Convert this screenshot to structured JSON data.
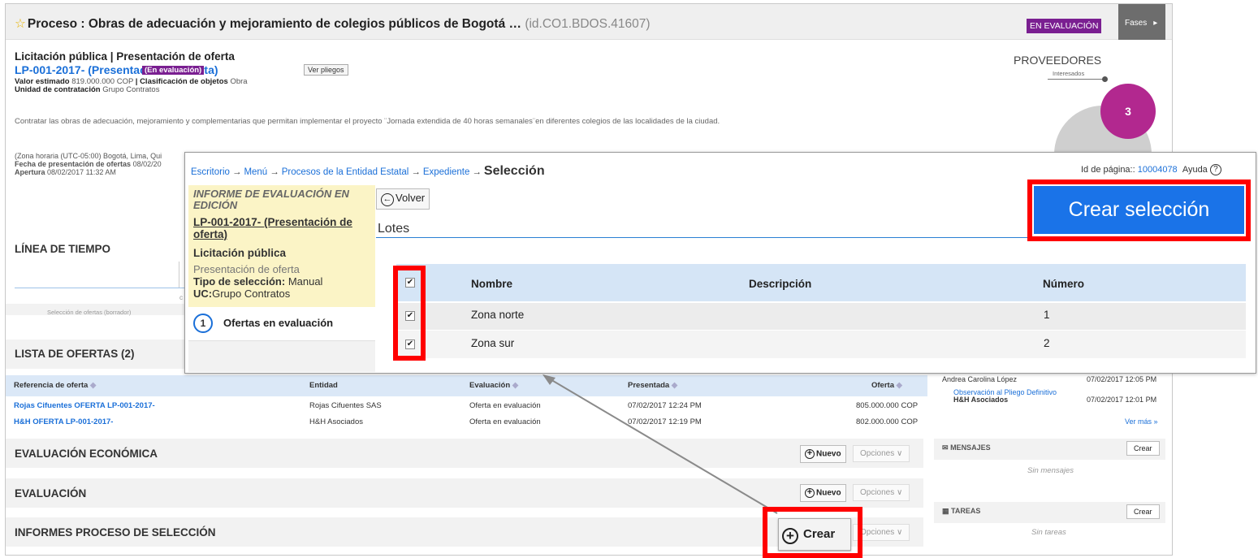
{
  "header": {
    "star_icon": "star-icon",
    "title": "Proceso : Obras de adecuación y mejoramiento de colegios públicos de Bogotá  …",
    "process_id": "(id.CO1.BDOS.41607)",
    "status_badge": "EN EVALUACIÓN",
    "phases_label": "Fases"
  },
  "process": {
    "type_line": "Licitación pública | Presentación de oferta",
    "reference": "LP-001-2017- (Presentación de oferta)",
    "status": "(En evaluación)",
    "ver_pliegos": "Ver pliegos",
    "valor_label": "Valor estimado",
    "valor_value": "819.000.000 COP",
    "clasif_label": "| Clasificación de objetos",
    "clasif_value": "Obra",
    "unidad_label": "Unidad de contratación",
    "unidad_value": "Grupo Contratos",
    "description": "Contratar las obras de adecuación, mejoramiento y complementarias que permitan implementar el proyecto ¨Jornada extendida de 40 horas semanales¨en diferentes colegios de las localidades de la ciudad.",
    "zona": "(Zona horaria (UTC-05:00) Bogotá, Lima, Qui",
    "fecha_label": "Fecha de presentación de ofertas",
    "fecha_value": "08/02/20",
    "apertura_label": "Apertura",
    "apertura_value": "08/02/2017 11:32 AM"
  },
  "proveedores": {
    "title": "PROVEEDORES",
    "subtitle": "Interesados",
    "count": "3"
  },
  "timeline": {
    "title": "LÍNEA DE TIEMPO",
    "label": "Selección de ofertas (borrador)",
    "frag": "c"
  },
  "offers": {
    "title": "LISTA DE OFERTAS (2)",
    "columns": [
      "Referencia de oferta",
      "Entidad",
      "Evaluación",
      "Presentada",
      "Oferta"
    ],
    "rows": [
      [
        "Rojas Cifuentes OFERTA LP-001-2017-",
        "Rojas Cifuentes SAS",
        "Oferta en evaluación",
        "07/02/2017 12:24 PM",
        "805.000.000 COP"
      ],
      [
        "H&H OFERTA LP-001-2017-",
        "H&H Asociados",
        "Oferta en evaluación",
        "07/02/2017 12:19 PM",
        "802.000.000 COP"
      ]
    ]
  },
  "sections": {
    "economica": "EVALUACIÓN ECONÓMICA",
    "evaluacion": "EVALUACIÓN",
    "informes": "INFORMES PROCESO DE SELECCIÓN",
    "nuevo": "Nuevo",
    "opciones": "Opciones ∨",
    "crear": "Crear"
  },
  "sidebar": {
    "obs1_name": "Andrea Carolina López",
    "obs1_date": "07/02/2017 12:05 PM",
    "obs2_title": "Observación al Pliego Definitivo",
    "obs2_name": "H&H Asociados",
    "obs2_date": "07/02/2017 12:01 PM",
    "ver_mas": "Ver más »",
    "mensajes": "MENSAJES",
    "sin_mensajes": "Sin mensajes",
    "tareas": "TAREAS",
    "sin_tareas": "Sin tareas",
    "crear": "Crear"
  },
  "overlay": {
    "breadcrumb": [
      "Escritorio",
      "Menú",
      "Procesos de la Entidad Estatal",
      "Expediente"
    ],
    "arrow": "→",
    "current": "Selección",
    "page_id_label": "Id de página::",
    "page_id": "10004078",
    "help": "Ayuda",
    "help_icon": "?",
    "report_status": "INFORME DE EVALUACIÓN EN EDICIÓN",
    "reference": "LP-001-2017- (Presentación de oferta)",
    "proc_type": "Licitación pública",
    "proc_phase": "Presentación de oferta",
    "sel_type_label": "Tipo de selección:",
    "sel_type_value": "Manual",
    "uc_label": "UC:",
    "uc_value": "Grupo Contratos",
    "step_number": "1",
    "step_label": "Ofertas en evaluación",
    "volver": "Volver",
    "lotes_title": "Lotes",
    "create_selection": "Crear selección",
    "lots_columns": [
      "Nombre",
      "Descripción",
      "Número"
    ],
    "lots": [
      {
        "name": "Zona norte",
        "description": "",
        "number": "1",
        "checked": true
      },
      {
        "name": "Zona sur",
        "description": "",
        "number": "2",
        "checked": true
      }
    ],
    "check_mark": "✔"
  },
  "colors": {
    "accent_blue": "#1a73e8",
    "link_blue": "#1a6fd8",
    "purple": "#7a1f91",
    "highlight_red": "#ff0000"
  }
}
